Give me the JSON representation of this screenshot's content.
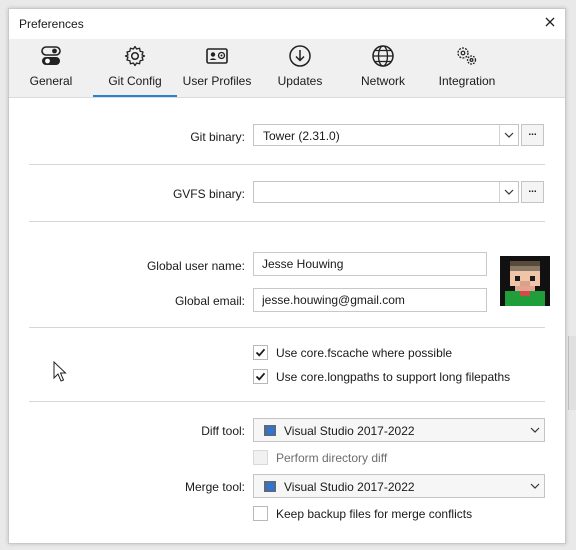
{
  "window": {
    "title": "Preferences"
  },
  "tabs": [
    {
      "label": "General",
      "icon": "toggles-icon"
    },
    {
      "label": "Git Config",
      "icon": "gear-icon"
    },
    {
      "label": "User Profiles",
      "icon": "id-card-icon"
    },
    {
      "label": "Updates",
      "icon": "download-icon"
    },
    {
      "label": "Network",
      "icon": "globe-icon"
    },
    {
      "label": "Integration",
      "icon": "gears-icon"
    }
  ],
  "active_tab": "Git Config",
  "git_binary": {
    "label": "Git binary:",
    "value": "Tower (2.31.0)",
    "browse": "..."
  },
  "gvfs_binary": {
    "label": "GVFS binary:",
    "value": "",
    "browse": "..."
  },
  "user": {
    "name_label": "Global user name:",
    "name_value": "Jesse Houwing",
    "email_label": "Global email:",
    "email_value": "jesse.houwing@gmail.com"
  },
  "options": {
    "fscache": {
      "label": "Use core.fscache where possible",
      "checked": true
    },
    "longpaths": {
      "label": "Use core.longpaths to support long filepaths",
      "checked": true
    }
  },
  "diff": {
    "label": "Diff tool:",
    "value": "Visual Studio 2017-2022",
    "dir_diff_label": "Perform directory diff",
    "dir_diff_checked": false
  },
  "merge": {
    "label": "Merge tool:",
    "value": "Visual Studio 2017-2022",
    "backup_label": "Keep backup files for merge conflicts",
    "backup_checked": false
  },
  "colors": {
    "accent": "#2d7fd0",
    "check": "#1a1a1a"
  }
}
